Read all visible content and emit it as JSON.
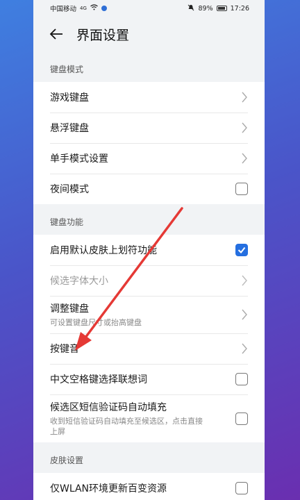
{
  "status": {
    "carrier": "中国移动",
    "signal": "4G",
    "battery": "89%",
    "time": "17:26"
  },
  "header": {
    "title": "界面设置"
  },
  "sections": [
    {
      "title": "键盘模式",
      "items": [
        {
          "label": "游戏键盘",
          "control": "chevron"
        },
        {
          "label": "悬浮键盘",
          "control": "chevron"
        },
        {
          "label": "单手模式设置",
          "control": "chevron"
        },
        {
          "label": "夜间模式",
          "control": "checkbox",
          "checked": false
        }
      ]
    },
    {
      "title": "键盘功能",
      "items": [
        {
          "label": "启用默认皮肤上划符功能",
          "control": "checkbox",
          "checked": true
        },
        {
          "label": "候选字体大小",
          "control": "chevron",
          "dim": true
        },
        {
          "label": "调整键盘",
          "sub": "可设置键盘尺寸或抬高键盘",
          "control": "chevron"
        },
        {
          "label": "按键音",
          "control": "chevron"
        },
        {
          "label": "中文空格键选择联想词",
          "control": "checkbox",
          "checked": false
        },
        {
          "label": "候选区短信验证码自动填充",
          "sub": "收到短信验证码自动填充至候选区，点击直接上屏",
          "control": "checkbox",
          "checked": false
        }
      ]
    },
    {
      "title": "皮肤设置",
      "items": [
        {
          "label": "仅WLAN环境更新百变资源",
          "control": "checkbox",
          "checked": false
        }
      ]
    }
  ],
  "colors": {
    "accent": "#256fe0",
    "annotation": "#e53935"
  }
}
